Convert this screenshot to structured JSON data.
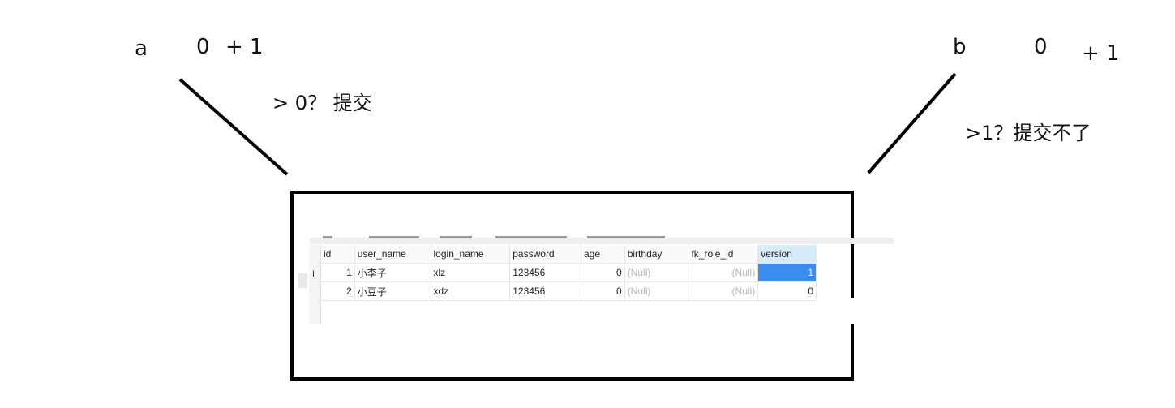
{
  "annotations": {
    "a_label": "a",
    "a_value": "0",
    "a_plus": "+ 1",
    "a_note": "> 0？ 提交",
    "b_label": "b",
    "b_value": "0",
    "b_plus": "+ 1",
    "b_note": ">1？提交不了"
  },
  "table": {
    "columns": [
      "id",
      "user_name",
      "login_name",
      "password",
      "age",
      "birthday",
      "fk_role_id",
      "version"
    ],
    "rows": [
      {
        "id": "1",
        "user_name": "小李子",
        "login_name": "xlz",
        "password": "123456",
        "age": "0",
        "birthday": "(Null)",
        "fk_role_id": "(Null)",
        "version": "1"
      },
      {
        "id": "2",
        "user_name": "小豆子",
        "login_name": "xdz",
        "password": "123456",
        "age": "0",
        "birthday": "(Null)",
        "fk_role_id": "(Null)",
        "version": "0"
      }
    ],
    "row_marker": "I"
  }
}
